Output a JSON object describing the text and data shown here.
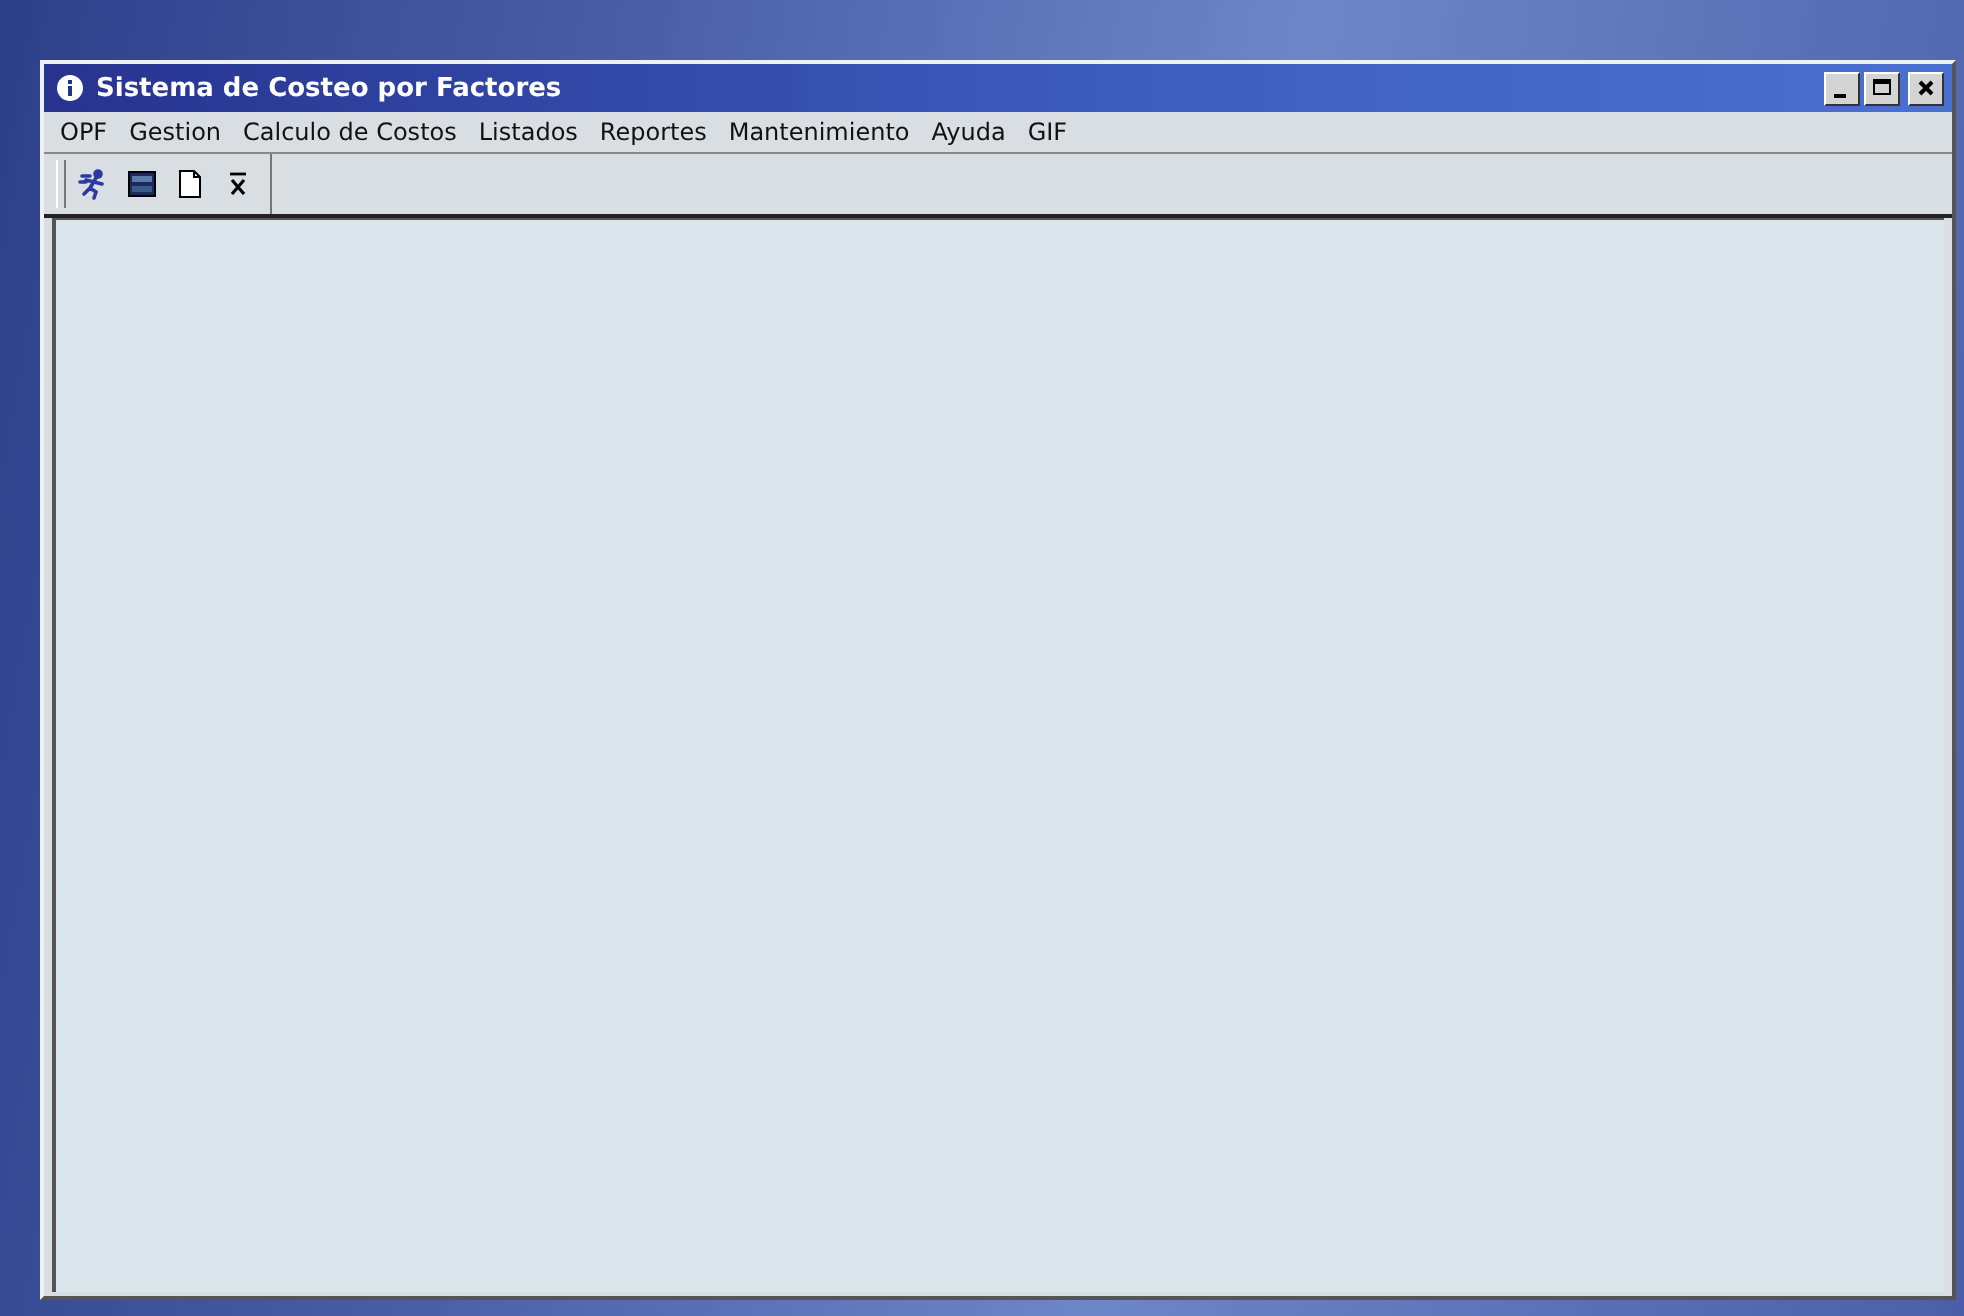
{
  "window": {
    "title": "Sistema de Costeo por Factores",
    "controls": [
      {
        "kind": "minimize"
      },
      {
        "kind": "maximize"
      },
      {
        "kind": "close"
      }
    ]
  },
  "menu": [
    {
      "label": "OPF"
    },
    {
      "label": "Gestion"
    },
    {
      "label": "Calculo de Costos"
    },
    {
      "label": "Listados"
    },
    {
      "label": "Reportes"
    },
    {
      "label": "Mantenimiento"
    },
    {
      "label": "Ayuda"
    },
    {
      "label": "GIF"
    }
  ],
  "toolbar": [
    {
      "kind": "runner"
    },
    {
      "kind": "panel"
    },
    {
      "kind": "page"
    },
    {
      "kind": "xbar"
    }
  ]
}
